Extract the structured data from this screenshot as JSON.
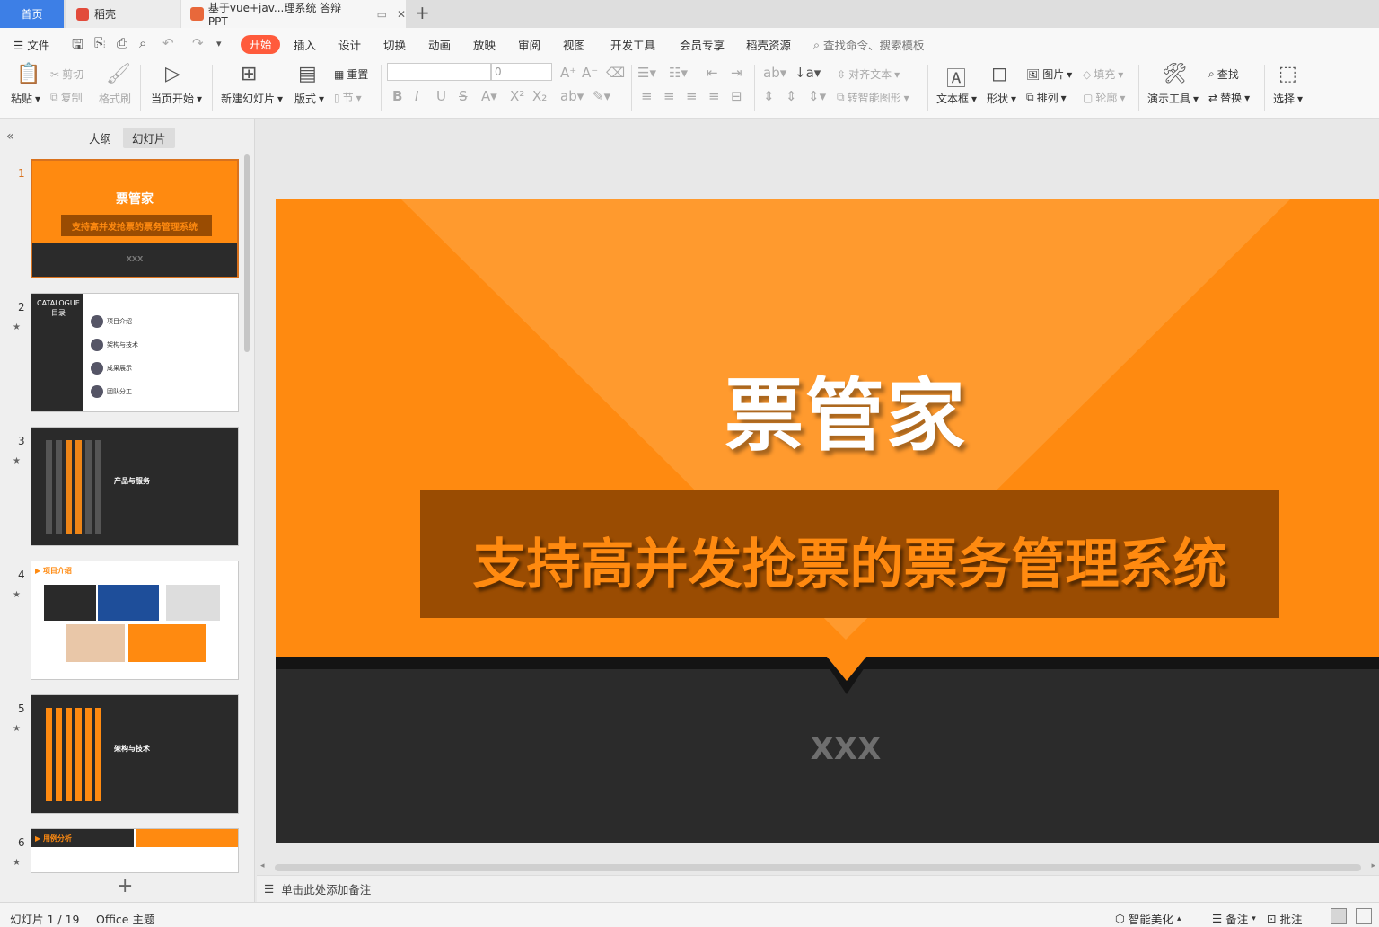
{
  "tabs": {
    "home": "首页",
    "daoke": "稻壳",
    "doc": "基于vue+jav...理系统 答辩PPT",
    "new_tab": "+"
  },
  "menu": {
    "file": "文件",
    "items": [
      "开始",
      "插入",
      "设计",
      "切换",
      "动画",
      "放映",
      "审阅",
      "视图",
      "开发工具",
      "会员专享",
      "稻壳资源"
    ],
    "search": "查找命令、搜索模板"
  },
  "ribbon": {
    "paste": "粘贴",
    "cut": "剪切",
    "copy": "复制",
    "format_painter": "格式刷",
    "play_from_current": "当页开始",
    "new_slide": "新建幻灯片",
    "layout": "版式",
    "reset": "重置",
    "section": "节",
    "font_size": "0",
    "align_text": "对齐文本",
    "smart_art": "转智能图形",
    "textbox": "文本框",
    "shape": "形状",
    "picture": "图片",
    "fill": "填充",
    "arrange": "排列",
    "outline": "轮廓",
    "presentation_tools": "演示工具",
    "find": "查找",
    "replace": "替换",
    "select": "选择"
  },
  "panel": {
    "outline_tab": "大纲",
    "slides_tab": "幻灯片",
    "slide_numbers": [
      "1",
      "2",
      "3",
      "4",
      "5",
      "6"
    ],
    "thumb1_title": "票管家",
    "thumb1_sub": "支持高并发抢票的票务管理系统",
    "thumb1_author": "XXX",
    "thumb2_catalogue": "CATALOGUE",
    "thumb2_catalogue_cn": "目录",
    "thumb2_items": [
      "项目介绍",
      "架构与技术",
      "成果展示",
      "团队分工"
    ],
    "thumb3_title": "产品与服务",
    "thumb4_title": "项目介绍",
    "thumb5_title": "架构与技术",
    "thumb6_title": "用例分析"
  },
  "slide": {
    "title": "票管家",
    "subtitle": "支持高并发抢票的票务管理系统",
    "author": "XXX"
  },
  "notes": {
    "placeholder": "单击此处添加备注"
  },
  "status": {
    "slide_counter": "幻灯片 1 / 19",
    "theme": "Office 主题",
    "smart_beautify": "智能美化",
    "notes": "备注",
    "comments": "批注"
  }
}
